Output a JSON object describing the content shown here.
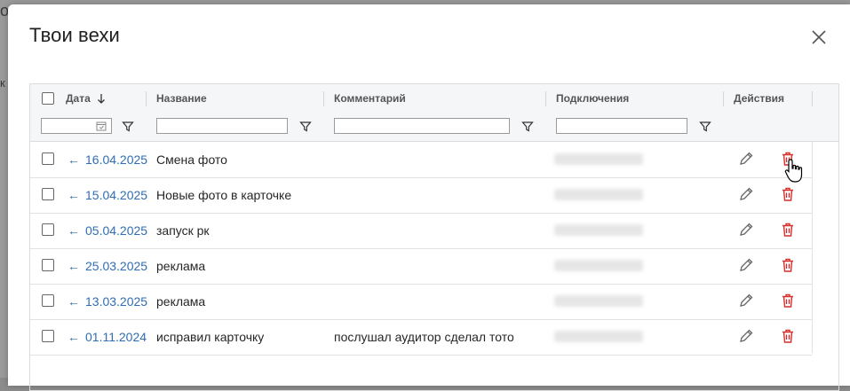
{
  "backdrop": {
    "fragment_1": "о",
    "fragment_2": "к"
  },
  "dialog": {
    "title": "Твои вехи",
    "close_icon": "close-icon"
  },
  "table": {
    "headers": {
      "date": "Дата",
      "date_sort_icon": "arrow-down-icon",
      "name": "Название",
      "comment": "Комментарий",
      "connections": "Подключения",
      "actions": "Действия"
    },
    "filters": {
      "date_value": "",
      "name_value": "",
      "comment_value": "",
      "connections_value": ""
    },
    "rows": [
      {
        "date": "16.04.2025",
        "name": "Смена фото",
        "comment": ""
      },
      {
        "date": "15.04.2025",
        "name": "Новые фото в карточке",
        "comment": ""
      },
      {
        "date": "05.04.2025",
        "name": "запуск рк",
        "comment": ""
      },
      {
        "date": "25.03.2025",
        "name": "реклама",
        "comment": ""
      },
      {
        "date": "13.03.2025",
        "name": "реклама",
        "comment": ""
      },
      {
        "date": "01.11.2024",
        "name": "исправил карточку",
        "comment": "послушал аудитор сделал тото"
      }
    ]
  },
  "colors": {
    "link": "#2f6db5",
    "delete": "#d32f2f",
    "header_bg": "#f5f6f8"
  }
}
